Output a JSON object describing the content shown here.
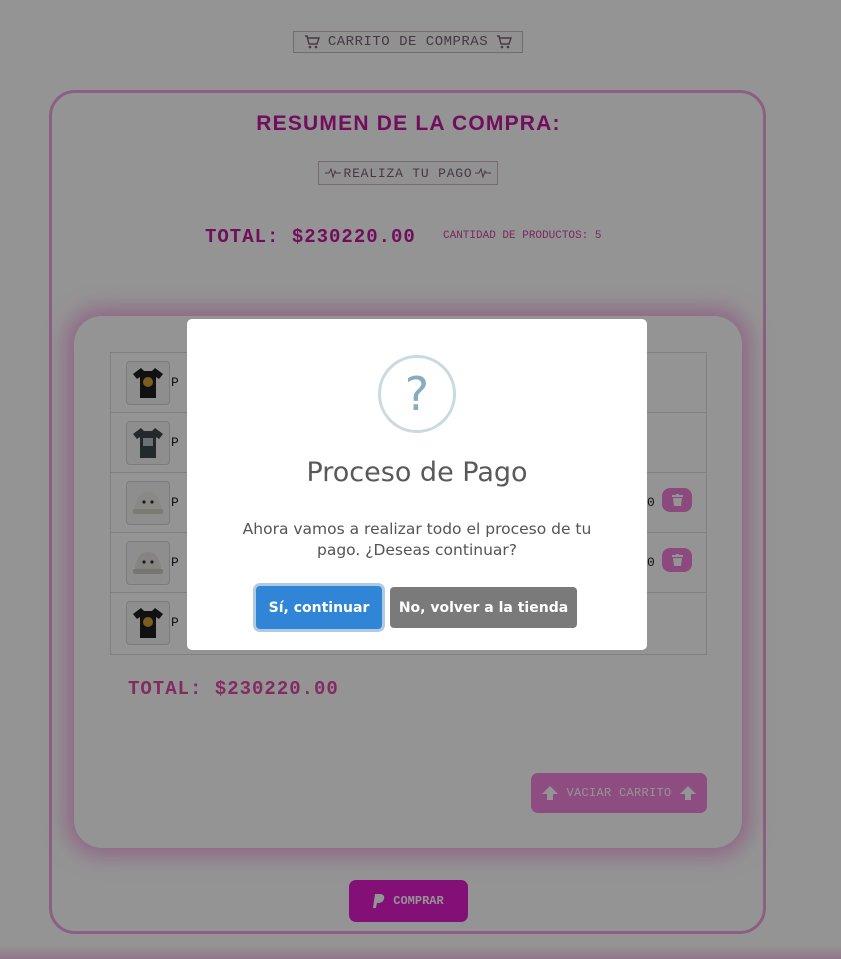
{
  "header": {
    "cart_title": "CARRITO DE COMPRAS",
    "cart_icon": "shopping-cart-icon"
  },
  "summary": {
    "title": "RESUMEN DE LA COMPRA:",
    "pay_label": "REALIZA TU PAGO",
    "total": "TOTAL: $230220.00",
    "quantity": "CANTIDAD DE PRODUCTOS: 5"
  },
  "cart": {
    "rows": [
      {
        "name": "P",
        "image": "black-tshirt-thumbnail",
        "price": "",
        "delete": false
      },
      {
        "name": "P",
        "image": "gray-tshirt-thumbnail",
        "price": "",
        "delete": false
      },
      {
        "name": "P",
        "image": "white-cap-thumbnail",
        "price": "0",
        "delete": true
      },
      {
        "name": "P",
        "image": "white-cap-thumbnail",
        "price": "0",
        "delete": true
      },
      {
        "name": "P",
        "image": "black-tshirt-thumbnail",
        "price": "",
        "delete": false
      }
    ],
    "total": "TOTAL: $230220.00",
    "empty_label": "VACIAR CARRITO",
    "buy_label": "COMPRAR"
  },
  "modal": {
    "icon": "question-icon",
    "icon_glyph": "?",
    "title": "Proceso de Pago",
    "text": "Ahora vamos a realizar todo el proceso de tu pago. ¿Deseas continuar?",
    "confirm_label": "Sí, continuar",
    "cancel_label": "No, volver a la tienda"
  },
  "colors": {
    "brand": "#c2189f",
    "accent_pink": "#f07fd8",
    "confirm": "#3085d6",
    "cancel": "#7a7a7a"
  }
}
